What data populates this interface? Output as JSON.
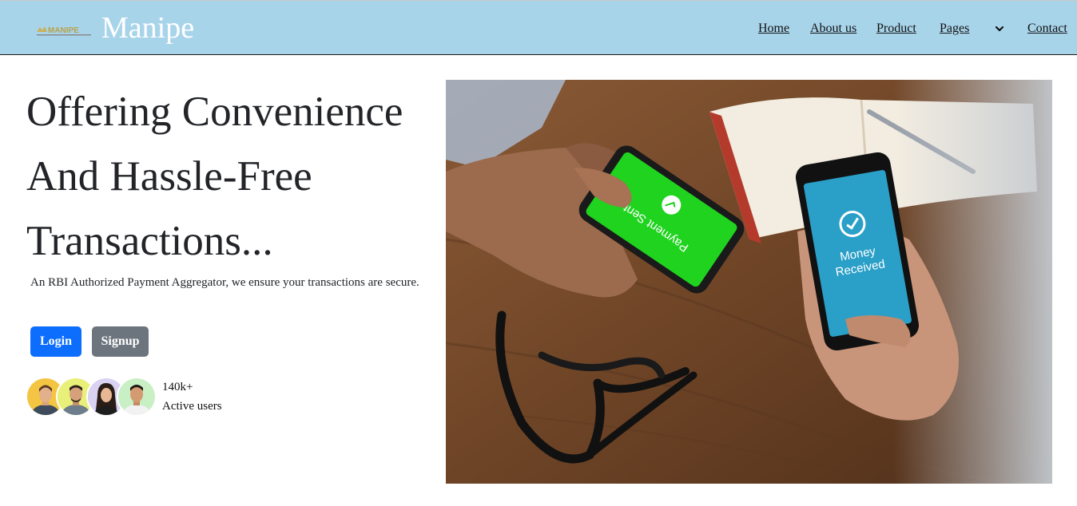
{
  "brand": {
    "logo_text": "MANIPE",
    "name": "Manipe"
  },
  "nav": {
    "items": [
      {
        "label": "Home"
      },
      {
        "label": "About us"
      },
      {
        "label": "Product"
      },
      {
        "label": "Pages"
      },
      {
        "label": "Contact"
      }
    ],
    "pages_dropdown_icon": "chevron-down-icon"
  },
  "hero": {
    "title": "Offering Convenience And Hassle-Free Transactions...",
    "subtitle": "An RBI Authorized Payment Aggregator, we ensure your transactions are secure.",
    "login_label": "Login",
    "signup_label": "Signup",
    "users_count": "140k+",
    "users_label": "Active users"
  },
  "image": {
    "left_phone_text": "Payment Sent",
    "right_phone_text_line1": "Money",
    "right_phone_text_line2": "Received"
  },
  "colors": {
    "navbar_bg": "#a8d4ea",
    "login_button": "#0d6efd",
    "signup_button": "#6c757d",
    "payment_sent_green": "#1fd31f",
    "money_received_blue": "#2a9fc7"
  }
}
